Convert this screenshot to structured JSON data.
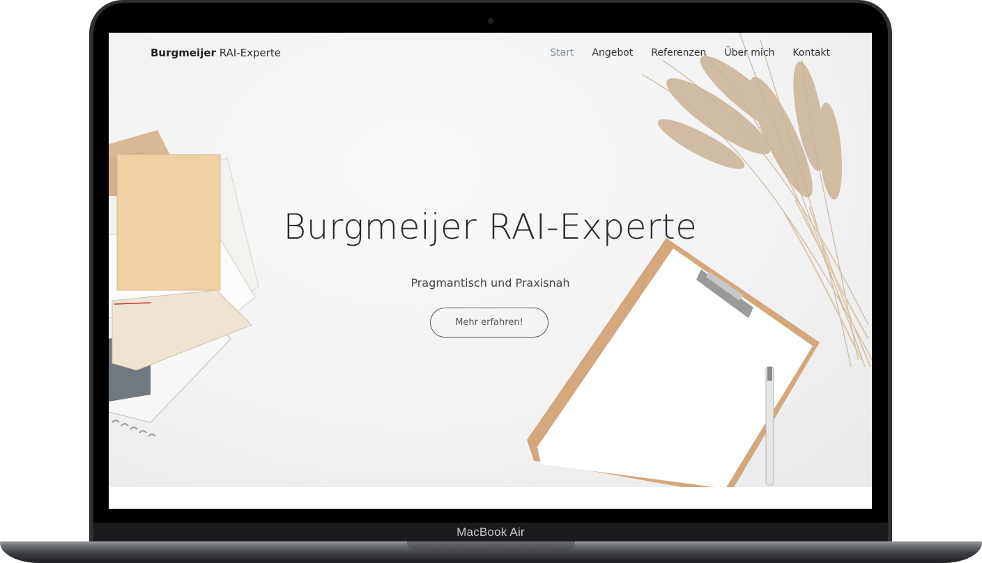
{
  "device": {
    "model_label": "MacBook Air"
  },
  "site": {
    "brand_bold": "Burgmeijer",
    "brand_light": "RAI-Experte",
    "nav": [
      {
        "label": "Start",
        "active": true
      },
      {
        "label": "Angebot",
        "active": false
      },
      {
        "label": "Referenzen",
        "active": false
      },
      {
        "label": "Über mich",
        "active": false
      },
      {
        "label": "Kontakt",
        "active": false
      }
    ],
    "hero": {
      "title": "Burgmeijer RAI-Experte",
      "subtitle": "Pragmantisch und Praxisnah",
      "button_label": "Mehr erfahren!"
    }
  },
  "colors": {
    "active_nav": "#7a8a94",
    "text": "#2a2a2a"
  }
}
